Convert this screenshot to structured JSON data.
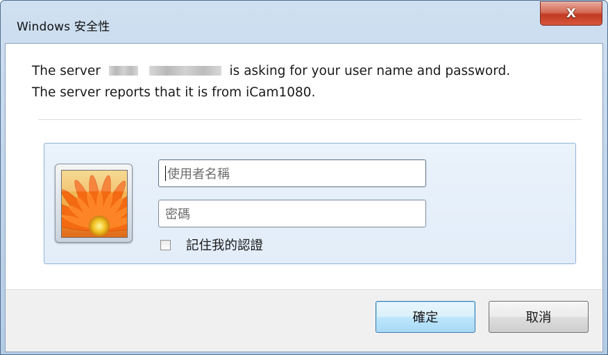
{
  "window": {
    "title": "Windows 安全性",
    "close_symbol": "X"
  },
  "message": {
    "line1_prefix": "The server",
    "line1_suffix": "is asking for your user name and password.",
    "line2": "The server reports that it is from iCam1080."
  },
  "credentials": {
    "avatar_icon": "user-tile-flower-icon",
    "username_placeholder": "使用者名稱",
    "password_placeholder": "密碼",
    "remember_label": "記住我的認證",
    "remember_checked": false
  },
  "buttons": {
    "ok_label": "確定",
    "cancel_label": "取消"
  },
  "colors": {
    "accent": "#3c7fb1",
    "panel_bg": "#e6f0fa",
    "close_red": "#c23a22"
  }
}
